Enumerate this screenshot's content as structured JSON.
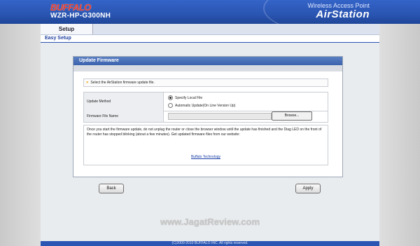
{
  "header": {
    "brand": "BUFFALO",
    "model": "WZR-HP-G300NH",
    "ap_label": "Wireless Access Point",
    "product": "AirStation"
  },
  "nav": {
    "tab_setup": "Setup",
    "sub_easy_setup": "Easy Setup"
  },
  "panel": {
    "title": "Update Firmware",
    "instruction": "Select the AirStation firmware update file.",
    "update_method_label": "Update Method",
    "option_local": "Specify Local File",
    "option_auto": "Automatic Update(On Line Version Up)",
    "selected_option": "local",
    "file_name_label": "Firmware File Name",
    "file_value": "",
    "browse_label": "Browse...",
    "notice": "Once you start the firmware update, do not unplug the router or close the browser window until the update has finished and the Diag LED on the front of the router has stopped blinking (about a few minutes). Get updated firmware files from our website:",
    "link": "Buffalo Technology"
  },
  "buttons": {
    "back": "Back",
    "apply": "Apply"
  },
  "watermark": "www.JagatReview.com",
  "footer": "(C)2000-2010 BUFFALO INC. All rights reserved.",
  "colors": {
    "header_blue": "#2a55b2",
    "brand_red": "#e83a2a",
    "link_blue": "#1a3fa8"
  }
}
